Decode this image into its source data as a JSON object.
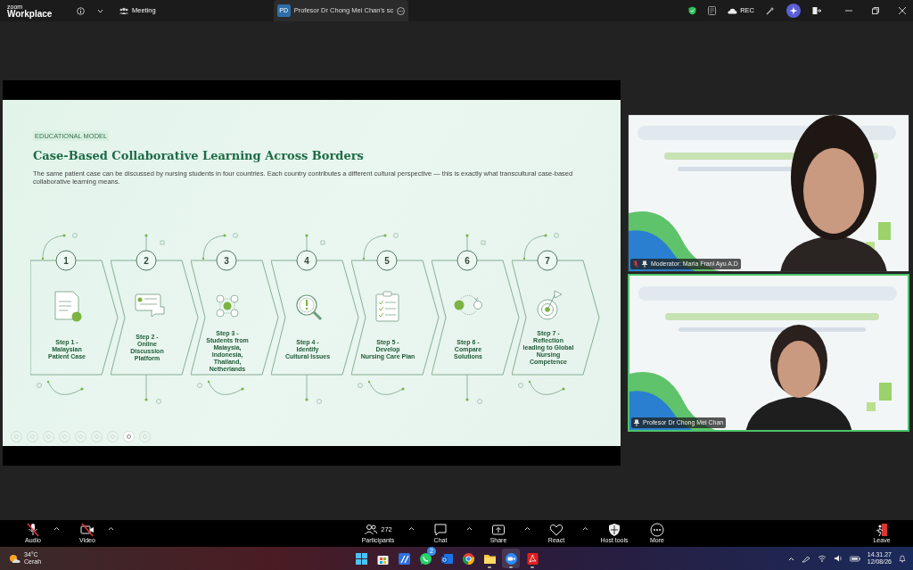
{
  "top_bar": {
    "logo_top": "zoom",
    "logo_bottom": "Workplace",
    "meeting_label": "Meeting",
    "tab": {
      "initials": "PD",
      "title": "Profesor Dr Chong Mei Chan's sc",
      "selected": true
    },
    "rec_label": "REC"
  },
  "slide": {
    "eyebrow": "EDUCATIONAL MODEL",
    "title": "Case-Based Collaborative Learning Across Borders",
    "subtitle": "The same patient case can be discussed by nursing students in four countries. Each country contributes a different cultural perspective — this is exactly what transcultural case-based collaborative learning means.",
    "steps": [
      {
        "number": "1",
        "lines": [
          "Step 1 -",
          "Malaysian",
          "Patient Case"
        ]
      },
      {
        "number": "2",
        "lines": [
          "Step 2 -",
          "Online",
          "Discussion",
          "Platform"
        ]
      },
      {
        "number": "3",
        "lines": [
          "Step 3 -",
          "Students from",
          "Malaysia,",
          "Indonesia,",
          "Thailand,",
          "Netherlands"
        ]
      },
      {
        "number": "4",
        "lines": [
          "Step 4 -",
          "Identify",
          "Cultural Issues"
        ]
      },
      {
        "number": "5",
        "lines": [
          "Step 5 -",
          "Develop",
          "Nursing Care Plan"
        ]
      },
      {
        "number": "6",
        "lines": [
          "Step 6 -",
          "Compare",
          "Solutions"
        ]
      },
      {
        "number": "7",
        "lines": [
          "Step 7 -",
          "Reflection",
          "leading to Global",
          "Nursing",
          "Competence"
        ]
      }
    ]
  },
  "video_tiles": [
    {
      "name": "Moderator: Maria Frani Ayu A.D",
      "muted": true,
      "active_speaker": false
    },
    {
      "name": "Profesor Dr Chong Mei Chan",
      "muted": false,
      "active_speaker": true
    }
  ],
  "toolbar": [
    {
      "kind": "audio",
      "label": "Audio",
      "off": true
    },
    {
      "kind": "video",
      "label": "Video",
      "off": true
    },
    {
      "kind": "participants",
      "label": "Participants",
      "count": "272",
      "off": false
    },
    {
      "kind": "chat",
      "label": "Chat",
      "off": false
    },
    {
      "kind": "share",
      "label": "Share",
      "off": false
    },
    {
      "kind": "react",
      "label": "React",
      "off": false
    },
    {
      "kind": "host",
      "label": "Host tools",
      "off": false
    },
    {
      "kind": "more",
      "label": "More",
      "off": false
    },
    {
      "kind": "leave",
      "label": "Leave",
      "off": false
    }
  ],
  "taskbar": {
    "weather": {
      "temp": "34°C",
      "condition": "Cerah"
    },
    "apps": [
      {
        "kind": "windows",
        "running": false
      },
      {
        "kind": "store",
        "running": false
      },
      {
        "kind": "editor",
        "running": false
      },
      {
        "kind": "whatsapp",
        "running": false,
        "badge": "2"
      },
      {
        "kind": "mail",
        "running": false
      },
      {
        "kind": "chrome",
        "running": false
      },
      {
        "kind": "files",
        "running": true
      },
      {
        "kind": "zoom",
        "running": true
      },
      {
        "kind": "pdf",
        "running": true
      }
    ],
    "time": "14.31.27",
    "date": "12/08/26"
  }
}
